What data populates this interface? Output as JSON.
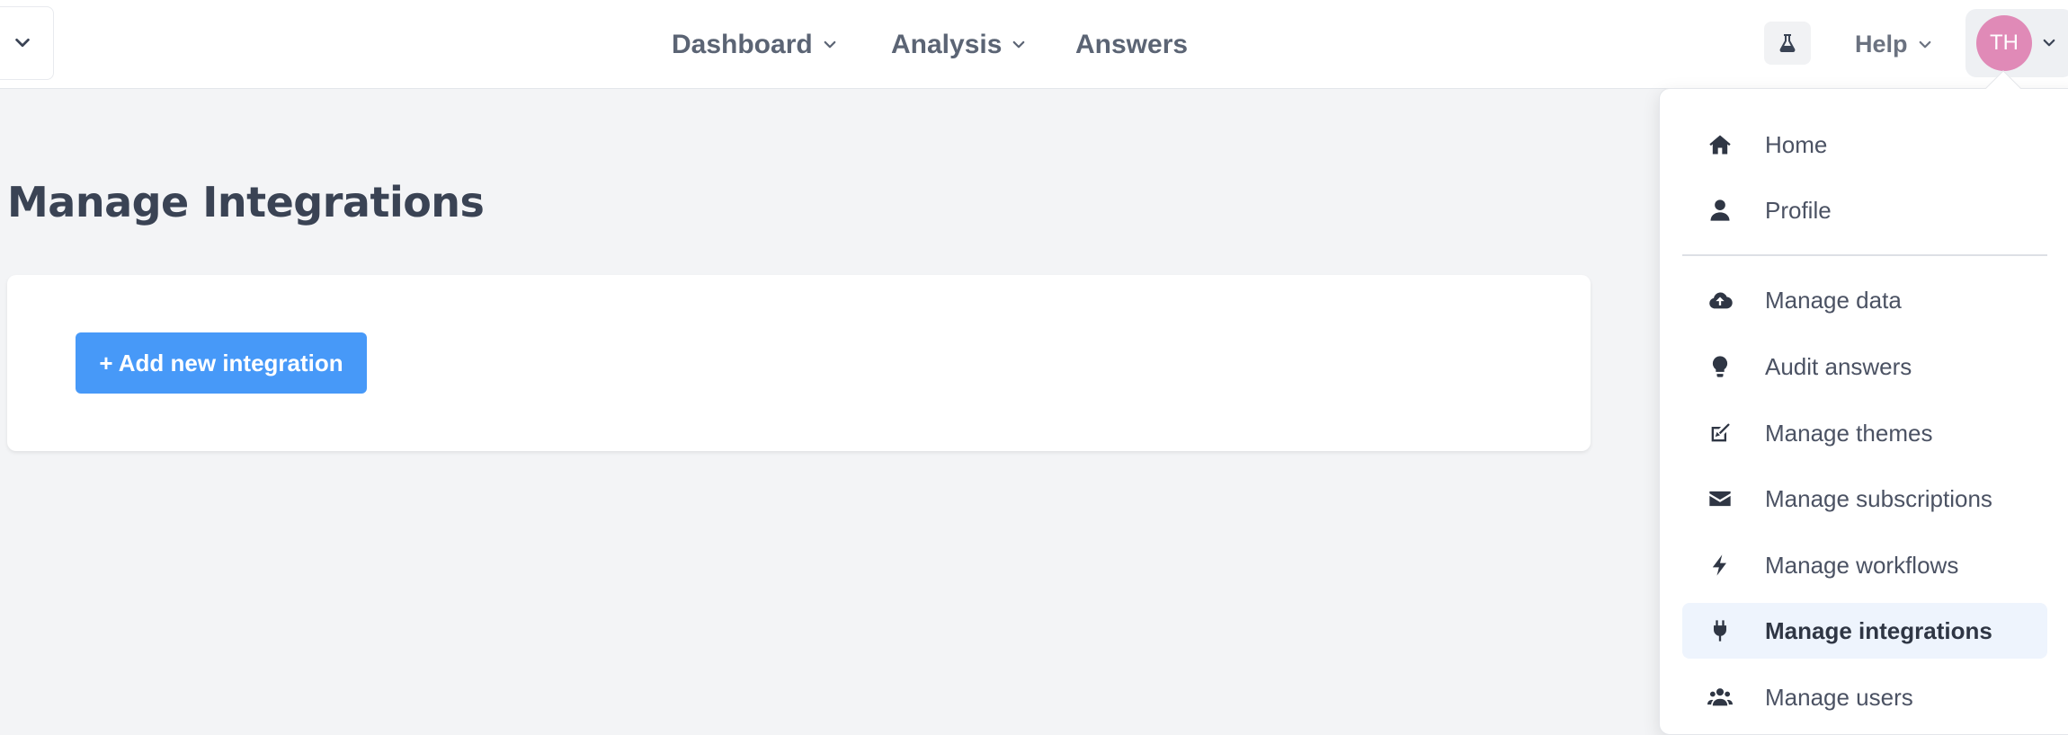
{
  "nav": {
    "dashboard_label": "Dashboard",
    "analysis_label": "Analysis",
    "answers_label": "Answers",
    "help_label": "Help",
    "user_initials": "TH"
  },
  "page": {
    "title": "Manage Integrations",
    "add_button_label": "+ Add new integration"
  },
  "menu": {
    "items": [
      {
        "label": "Home",
        "icon": "home-icon"
      },
      {
        "label": "Profile",
        "icon": "user-icon"
      },
      {
        "label": "Manage data",
        "icon": "cloud-upload-icon"
      },
      {
        "label": "Audit answers",
        "icon": "lightbulb-icon"
      },
      {
        "label": "Manage themes",
        "icon": "brush-icon"
      },
      {
        "label": "Manage subscriptions",
        "icon": "envelope-icon"
      },
      {
        "label": "Manage workflows",
        "icon": "bolt-icon"
      },
      {
        "label": "Manage integrations",
        "icon": "plug-icon",
        "active": true
      },
      {
        "label": "Manage users",
        "icon": "users-icon"
      }
    ]
  },
  "colors": {
    "accent": "#4799f8",
    "avatar": "#e08ab7",
    "active_item_bg": "#eef4fd",
    "page_bg": "#f3f4f6"
  }
}
